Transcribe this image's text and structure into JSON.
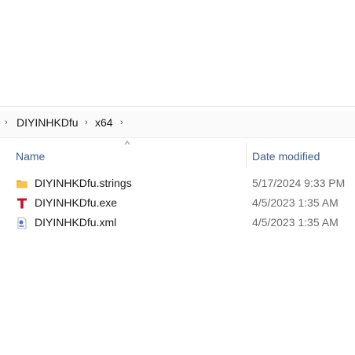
{
  "breadcrumb": {
    "items": [
      "DIYINHKDfu",
      "x64"
    ]
  },
  "columns": {
    "name": "Name",
    "date_modified": "Date modified"
  },
  "files": [
    {
      "name": "DIYINHKDfu.strings",
      "date": "5/17/2024 9:33 PM",
      "icon": "folder-icon"
    },
    {
      "name": "DIYINHKDfu.exe",
      "date": "4/5/2023 1:35 AM",
      "icon": "exe-app-icon"
    },
    {
      "name": "DIYINHKDfu.xml",
      "date": "4/5/2023 1:35 AM",
      "icon": "xml-file-icon"
    }
  ],
  "colors": {
    "header_text": "#3a5f8f",
    "date_text": "#6b6b6b",
    "folder": "#f2c14e",
    "exe": "#c8102e"
  }
}
